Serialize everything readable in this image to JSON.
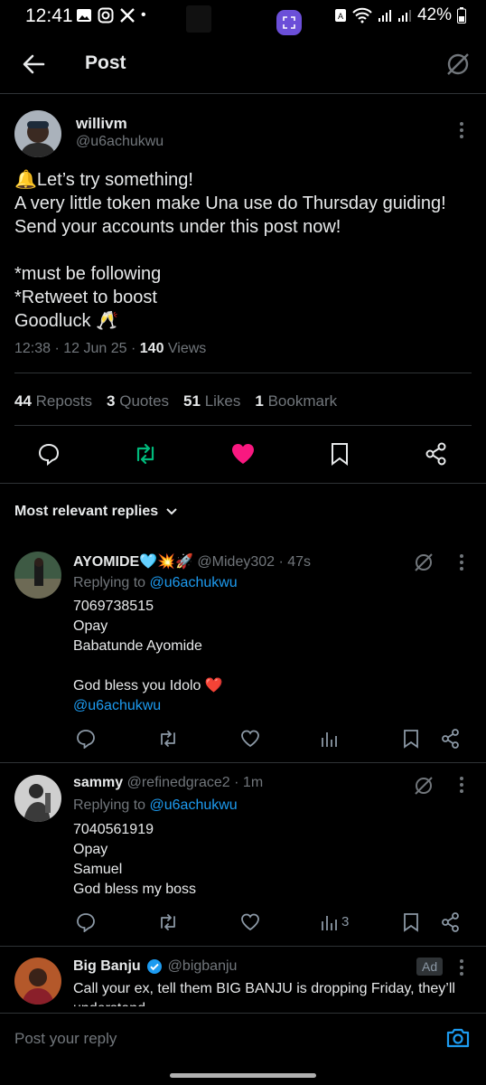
{
  "status_bar": {
    "time": "12:41",
    "battery": "42%",
    "dot": "•"
  },
  "header": {
    "title": "Post"
  },
  "post": {
    "author_name": "willivm",
    "author_handle": "@u6achukwu",
    "text": "🔔Let’s try something!\nA very little token make Una use do Thursday guiding!\nSend your accounts under this post now!\n\n*must be following\n*Retweet to boost\n Goodluck  🥂",
    "time": "12:38 · 12 Jun 25 · ",
    "views_count": "140",
    "views_label": " Views",
    "stats": {
      "reposts_count": "44",
      "reposts_label": "Reposts",
      "quotes_count": "3",
      "quotes_label": "Quotes",
      "likes_count": "51",
      "likes_label": "Likes",
      "bookmarks_count": "1",
      "bookmarks_label": "Bookmark"
    },
    "colors": {
      "repost": "#00ba7c",
      "like": "#f91880"
    }
  },
  "replies_sort": {
    "label": "Most relevant replies"
  },
  "replies": [
    {
      "name": "AYOMIDE🩵💥🚀",
      "handle": "@Midey302 · 47s",
      "replying_prefix": "Replying to ",
      "replying_to": "@u6achukwu",
      "text": "7069738515\nOpay\nBabatunde Ayomide\n\nGod bless you Idolo ❤️",
      "mention": "@u6achukwu",
      "views": ""
    },
    {
      "name": "sammy",
      "handle": "@refinedgrace2 · 1m",
      "replying_prefix": "Replying to ",
      "replying_to": "@u6achukwu",
      "text": "7040561919\nOpay\nSamuel\nGod bless my boss",
      "views": "3"
    },
    {
      "name": "Big Banju",
      "handle": "@bigbanju",
      "ad_label": "Ad",
      "text": "Call your ex, tell them BIG BANJU is dropping Friday, they’ll understand"
    }
  ],
  "composer": {
    "placeholder": "Post your reply"
  },
  "icons": {
    "accent": "#1d9bf0",
    "muted": "#71767b"
  }
}
